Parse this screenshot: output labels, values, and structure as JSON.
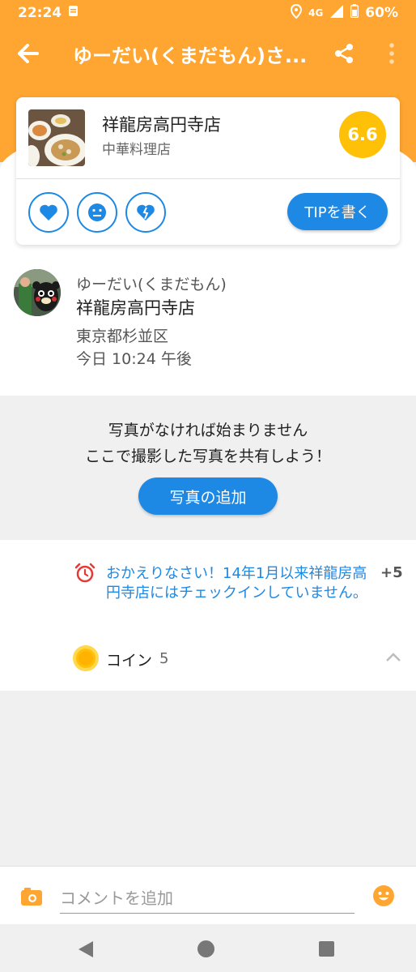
{
  "status_bar": {
    "time": "22:24",
    "network": "4G",
    "battery": "60%"
  },
  "app_bar": {
    "title": "ゆーだい(くまだもん)さ..."
  },
  "venue": {
    "name": "祥龍房高円寺店",
    "category": "中華料理店",
    "score": "6.6",
    "tip_button": "TIPを書く"
  },
  "checkin": {
    "user": "ゆーだい(くまだもん)",
    "venue": "祥龍房高円寺店",
    "area": "東京都杉並区",
    "time": "今日 10:24 午後"
  },
  "photo_prompt": {
    "line1": "写真がなければ始まりません",
    "line2": "ここで撮影した写真を共有しよう！",
    "button": "写真の追加"
  },
  "bonus": {
    "message": "おかえりなさい！14年1月以来祥龍房高円寺店にはチェックインしていません。",
    "points": "+5",
    "coin_label": "コイン",
    "coin_count": "5"
  },
  "comment": {
    "placeholder": "コメントを追加"
  },
  "colors": {
    "brand_orange": "#ffa531",
    "accent_blue": "#1e88e5",
    "score_yellow": "#ffc107",
    "alarm_red": "#e53935"
  }
}
